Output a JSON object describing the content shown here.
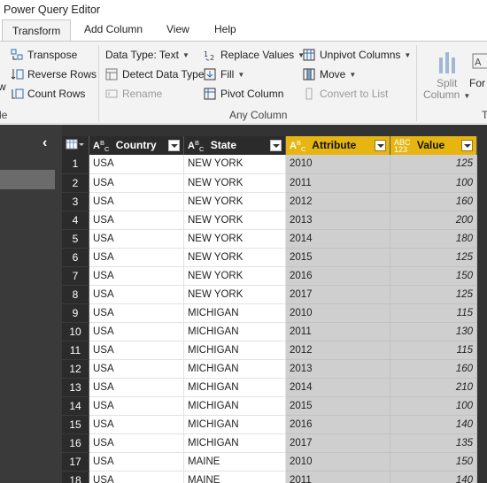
{
  "window": {
    "title": "Power Query Editor"
  },
  "tabs": [
    {
      "label": "Transform",
      "active": true
    },
    {
      "label": "Add Column",
      "active": false
    },
    {
      "label": "View",
      "active": false
    },
    {
      "label": "Help",
      "active": false
    }
  ],
  "ribbon": {
    "left_edge": {
      "top_label": "w",
      "group_label": "le"
    },
    "table_group": {
      "transpose": "Transpose",
      "reverse_rows": "Reverse Rows",
      "count_rows": "Count Rows"
    },
    "any_column": {
      "data_type": "Data Type: Text",
      "detect_data_type": "Detect Data Type",
      "rename": "Rename",
      "replace_values": "Replace Values",
      "fill": "Fill",
      "pivot_column": "Pivot Column",
      "unpivot_columns": "Unpivot Columns",
      "move": "Move",
      "convert_to_list": "Convert to List",
      "group_label": "Any Column"
    },
    "text_group": {
      "split_column_line1": "Split",
      "split_column_line2": "Column",
      "format_partial": "For",
      "group_label_partial": "T"
    }
  },
  "grid": {
    "columns": [
      {
        "name": "Country",
        "type": "text"
      },
      {
        "name": "State",
        "type": "text"
      },
      {
        "name": "Attribute",
        "type": "text"
      },
      {
        "name": "Value",
        "type": "number"
      }
    ],
    "rows": [
      {
        "n": "1",
        "country": "USA",
        "state": "NEW YORK",
        "attribute": "2010",
        "value": "125"
      },
      {
        "n": "2",
        "country": "USA",
        "state": "NEW YORK",
        "attribute": "2011",
        "value": "100"
      },
      {
        "n": "3",
        "country": "USA",
        "state": "NEW YORK",
        "attribute": "2012",
        "value": "160"
      },
      {
        "n": "4",
        "country": "USA",
        "state": "NEW YORK",
        "attribute": "2013",
        "value": "200"
      },
      {
        "n": "5",
        "country": "USA",
        "state": "NEW YORK",
        "attribute": "2014",
        "value": "180"
      },
      {
        "n": "6",
        "country": "USA",
        "state": "NEW YORK",
        "attribute": "2015",
        "value": "125"
      },
      {
        "n": "7",
        "country": "USA",
        "state": "NEW YORK",
        "attribute": "2016",
        "value": "150"
      },
      {
        "n": "8",
        "country": "USA",
        "state": "NEW YORK",
        "attribute": "2017",
        "value": "125"
      },
      {
        "n": "9",
        "country": "USA",
        "state": "MICHIGAN",
        "attribute": "2010",
        "value": "115"
      },
      {
        "n": "10",
        "country": "USA",
        "state": "MICHIGAN",
        "attribute": "2011",
        "value": "130"
      },
      {
        "n": "11",
        "country": "USA",
        "state": "MICHIGAN",
        "attribute": "2012",
        "value": "115"
      },
      {
        "n": "12",
        "country": "USA",
        "state": "MICHIGAN",
        "attribute": "2013",
        "value": "160"
      },
      {
        "n": "13",
        "country": "USA",
        "state": "MICHIGAN",
        "attribute": "2014",
        "value": "210"
      },
      {
        "n": "14",
        "country": "USA",
        "state": "MICHIGAN",
        "attribute": "2015",
        "value": "100"
      },
      {
        "n": "15",
        "country": "USA",
        "state": "MICHIGAN",
        "attribute": "2016",
        "value": "140"
      },
      {
        "n": "16",
        "country": "USA",
        "state": "MICHIGAN",
        "attribute": "2017",
        "value": "135"
      },
      {
        "n": "17",
        "country": "USA",
        "state": "MAINE",
        "attribute": "2010",
        "value": "150"
      },
      {
        "n": "18",
        "country": "USA",
        "state": "MAINE",
        "attribute": "2011",
        "value": "140"
      }
    ]
  },
  "colors": {
    "accent_header": "#e6b512",
    "dark_pane": "#3a3a3a",
    "ribbon_bg": "#f3f3f3"
  }
}
